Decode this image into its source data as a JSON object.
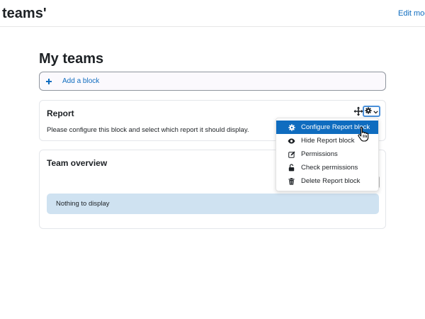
{
  "header": {
    "site_title": "teams'",
    "edit_mode_label": "Edit mod"
  },
  "page": {
    "title": "My teams"
  },
  "add_block": {
    "label": "Add a block",
    "icon": "plus-icon"
  },
  "report_block": {
    "title": "Report",
    "message": "Please configure this block and select which report it should display."
  },
  "team_block": {
    "title": "Team overview",
    "empty_message": "Nothing to display"
  },
  "actions_menu": {
    "items": [
      {
        "label": "Configure Report block",
        "icon": "gear-icon",
        "active": true
      },
      {
        "label": "Hide Report block",
        "icon": "eye-icon",
        "active": false
      },
      {
        "label": "Permissions",
        "icon": "edit-icon",
        "active": false
      },
      {
        "label": "Check permissions",
        "icon": "unlock-icon",
        "active": false
      },
      {
        "label": "Delete Report block",
        "icon": "trash-icon",
        "active": false
      }
    ]
  },
  "colors": {
    "accent": "#0f6cbf",
    "alert_info_bg": "#cfe2f1",
    "text": "#1d2125"
  }
}
